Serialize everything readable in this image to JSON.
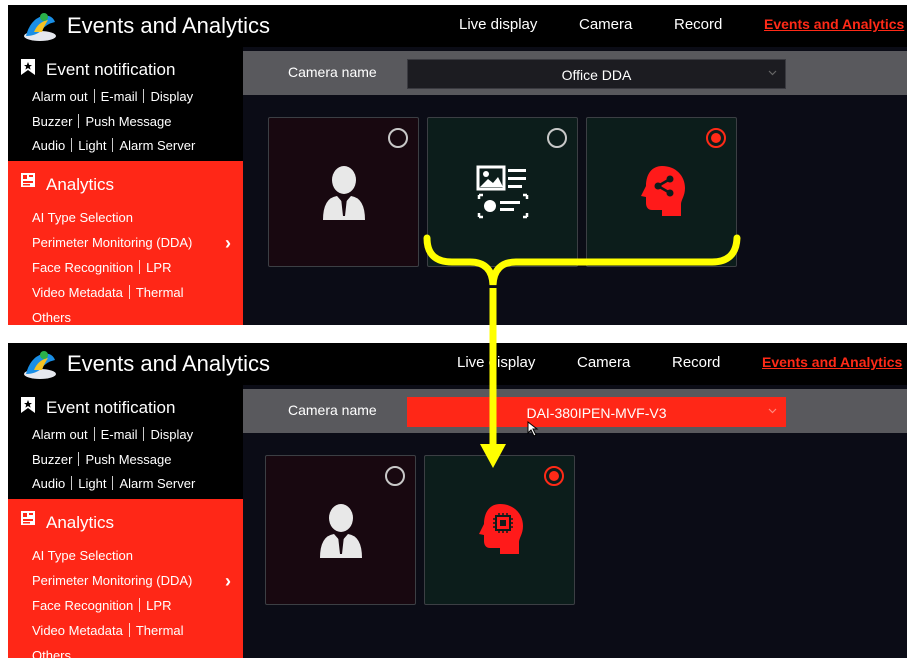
{
  "top": {
    "title": "Events and Analytics",
    "nav": [
      "Live display",
      "Camera",
      "Record",
      "Events and Analytics"
    ],
    "event_notification": {
      "title": "Event notification",
      "rows": [
        [
          "Alarm out",
          "E-mail",
          "Display"
        ],
        [
          "Buzzer",
          "Push Message"
        ],
        [
          "Audio",
          "Light",
          "Alarm Server"
        ]
      ]
    },
    "analytics": {
      "title": "Analytics",
      "rows": [
        [
          "AI Type Selection"
        ],
        [
          "Perimeter Monitoring (DDA)"
        ],
        [
          "Face Recognition",
          "LPR"
        ],
        [
          "Video Metadata",
          "Thermal"
        ],
        [
          "Others"
        ]
      ],
      "chevron": "›"
    },
    "camera_label": "Camera name",
    "camera_value": "Office DDA",
    "ai_types": [
      "face-recognition",
      "video-metadata",
      "deep-learning-analytics"
    ],
    "selected_ai_type": "deep-learning-analytics"
  },
  "bottom": {
    "title": "Events and Analytics",
    "nav": [
      "Live display",
      "Camera",
      "Record",
      "Events and Analytics"
    ],
    "event_notification": {
      "title": "Event notification",
      "rows": [
        [
          "Alarm out",
          "E-mail",
          "Display"
        ],
        [
          "Buzzer",
          "Push Message"
        ],
        [
          "Audio",
          "Light",
          "Alarm Server"
        ]
      ]
    },
    "analytics": {
      "title": "Analytics",
      "rows": [
        [
          "AI Type Selection"
        ],
        [
          "Perimeter Monitoring (DDA)"
        ],
        [
          "Face Recognition",
          "LPR"
        ],
        [
          "Video Metadata",
          "Thermal"
        ],
        [
          "Others"
        ]
      ],
      "chevron": "›"
    },
    "camera_label": "Camera name",
    "camera_value": "DAI-380IPEN-MVF-V3",
    "ai_types": [
      "face-recognition",
      "ai-chip-analytics"
    ],
    "selected_ai_type": "ai-chip-analytics"
  },
  "colors": {
    "accent": "#ff2717",
    "annotation": "#ffff00",
    "panel_bg": "#0b0c16",
    "camera_bar": "#59595d"
  },
  "icons": {
    "app": "app-logo-icon",
    "event": "bookmark-icon",
    "analytics": "analytics-icon",
    "face": "person-silhouette-icon",
    "metadata": "image-document-icon",
    "analytics_head": "brain-share-icon",
    "chip_head": "brain-chip-icon",
    "cursor": "mouse-cursor-icon"
  },
  "annotation": {
    "description_type": "curly-brace-with-down-arrow",
    "color": "#ffff00"
  }
}
